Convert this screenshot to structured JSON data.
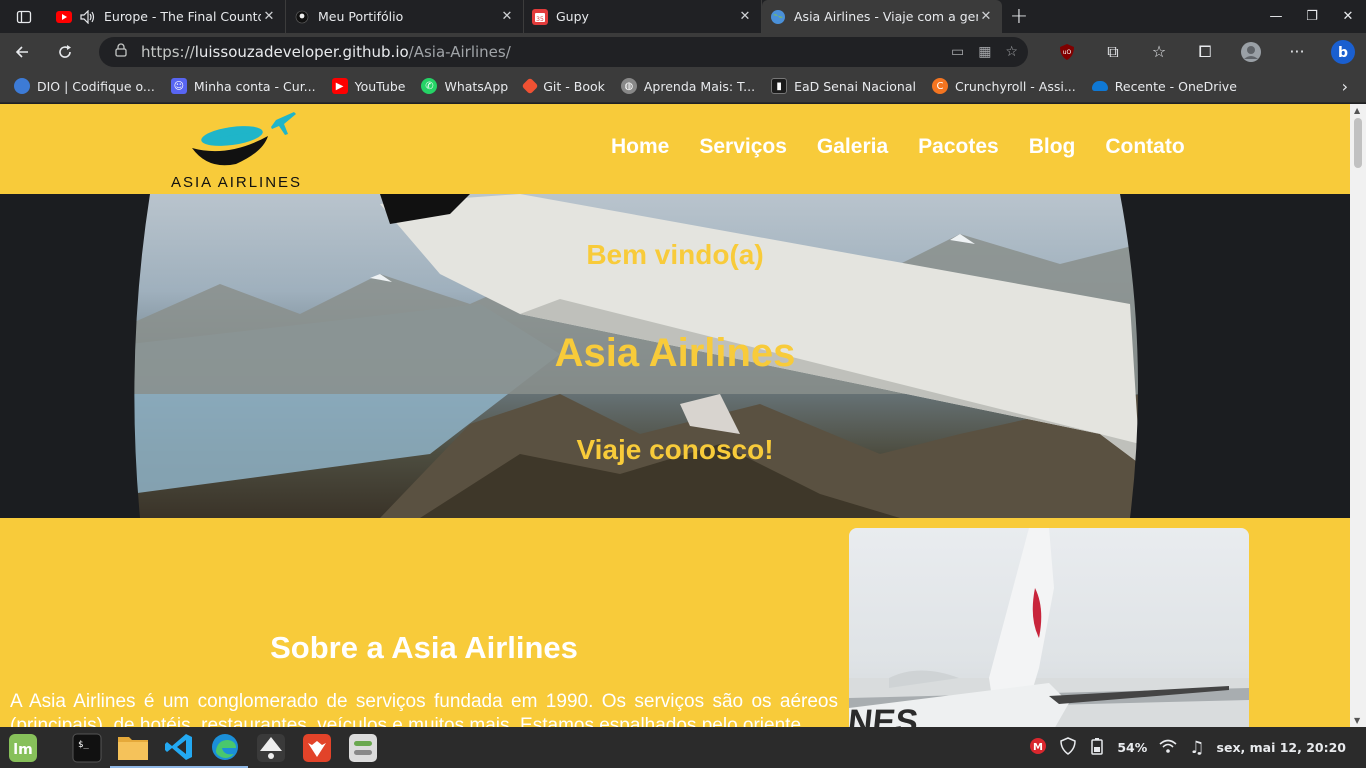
{
  "browser": {
    "tabs": [
      {
        "label": "Europe - The Final Countdown",
        "icon": "youtube-icon",
        "audio": true
      },
      {
        "label": "Meu Portifólio",
        "icon": "github-icon"
      },
      {
        "label": "Gupy",
        "icon": "gupy-icon"
      },
      {
        "label": "Asia Airlines - Viaje com a gente",
        "icon": "globe-icon",
        "active": true
      }
    ],
    "address": {
      "scheme": "https://",
      "domain": "luissouzadeveloper.github.io",
      "path": "/Asia-Airlines/"
    },
    "bookmarks": [
      {
        "label": "DIO | Codifique o...",
        "icon": "dio-icon",
        "color": "#3d7bd6"
      },
      {
        "label": "Minha conta - Cur...",
        "icon": "discord-icon",
        "color": "#5865f2"
      },
      {
        "label": "YouTube",
        "icon": "youtube-icon",
        "color": "#ff0000"
      },
      {
        "label": "WhatsApp",
        "icon": "whatsapp-icon",
        "color": "#25d366"
      },
      {
        "label": "Git - Book",
        "icon": "git-icon",
        "color": "#f05133"
      },
      {
        "label": "Aprenda Mais: T...",
        "icon": "globe-icon",
        "color": "#888888"
      },
      {
        "label": "EaD Senai Nacional",
        "icon": "senai-icon",
        "color": "#1b1b1b"
      },
      {
        "label": "Crunchyroll - Assi...",
        "icon": "crunchyroll-icon",
        "color": "#f47521"
      },
      {
        "label": "Recente - OneDrive",
        "icon": "onedrive-icon",
        "color": "#0f78d4"
      }
    ]
  },
  "site": {
    "logo_text": "ASIA AIRLINES",
    "menu": [
      "Home",
      "Serviços",
      "Galeria",
      "Pacotes",
      "Blog",
      "Contato"
    ],
    "hero": {
      "welcome": "Bem vindo(a)",
      "title": "Asia Airlines",
      "tagline": "Viaje conosco!"
    },
    "about": {
      "title": "Sobre a Asia Airlines",
      "text": "A Asia Airlines é um conglomerado de serviços fundada em 1990. Os serviços são os aéreos (principais), de hotéis, restaurantes, veículos e muitos mais. Estamos espalhados pelo oriente"
    },
    "colors": {
      "brand_yellow": "#f8cb3a",
      "white": "#ffffff"
    }
  },
  "taskbar": {
    "apps": [
      "mint-menu-icon",
      "terminal-icon",
      "files-icon",
      "vscode-icon",
      "edge-icon",
      "inkscape-icon",
      "gitlab-icon",
      "settings-icon"
    ],
    "tray": {
      "battery": "54%",
      "clock": "sex, mai 12, 20:20"
    }
  }
}
